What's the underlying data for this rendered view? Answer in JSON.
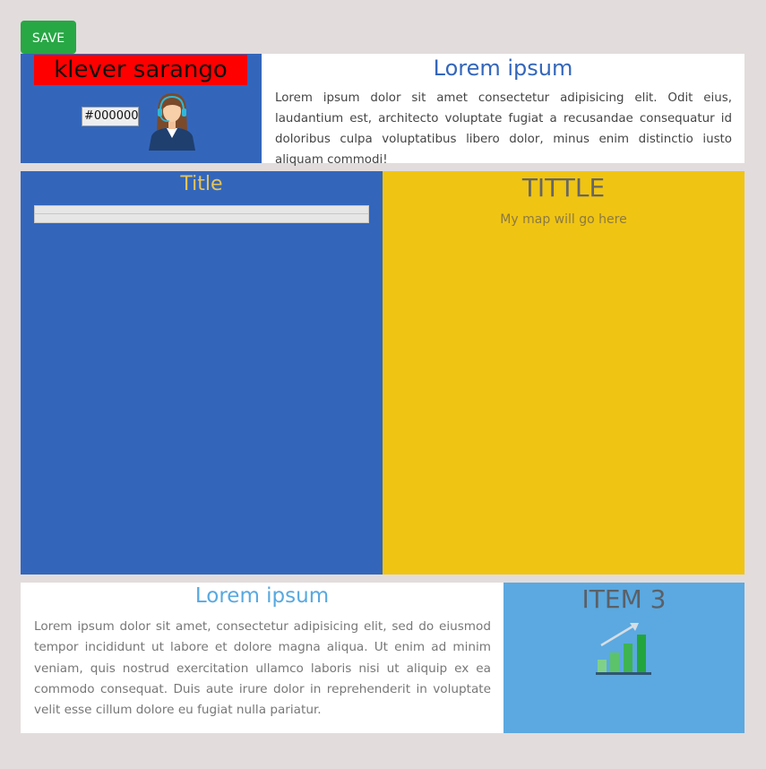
{
  "toolbar": {
    "save_label": "SAVE"
  },
  "profile": {
    "name": "klever sarango",
    "color_value": "#000000",
    "avatar_icon": "support-agent-icon"
  },
  "intro": {
    "title": "Lorem ipsum",
    "text": "Lorem ipsum dolor sit amet consectetur adipisicing elit. Odit eius, laudantium est, architecto voluptate fugiat a recusandae consequatur id doloribus culpa voluptatibus libero dolor, minus enim distinctio iusto aliquam commodi!"
  },
  "left_panel": {
    "title": "Title"
  },
  "right_panel": {
    "title": "TITTLE",
    "placeholder": "My map will go here"
  },
  "bottom": {
    "title": "Lorem ipsum",
    "text": "Lorem ipsum dolor sit amet, consectetur adipisicing elit, sed do eiusmod tempor incididunt ut labore et dolore magna aliqua. Ut enim ad minim veniam, quis nostrud exercitation ullamco laboris nisi ut aliquip ex ea commodo consequat. Duis aute irure dolor in reprehenderit in voluptate velit esse cillum dolore eu fugiat nulla pariatur."
  },
  "item3": {
    "title": "ITEM 3",
    "icon": "growth-chart-icon"
  },
  "colors": {
    "page_bg": "#e2dcdc",
    "save_green": "#28a745",
    "blue": "#3366bb",
    "yellow": "#f0c412",
    "light_blue": "#5ba9e0",
    "red": "#ff0000"
  }
}
